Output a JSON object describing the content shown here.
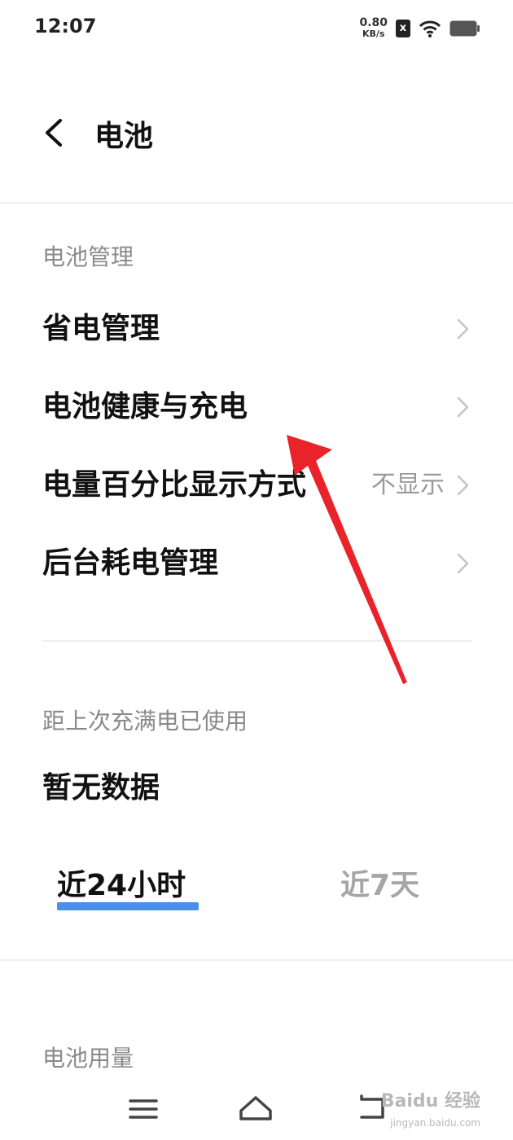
{
  "status_bar": {
    "time": "12:07",
    "net_speed_value": "0.80",
    "net_speed_unit": "KB/s",
    "sim_icon_glyph": "x"
  },
  "header": {
    "title": "电池"
  },
  "battery_management": {
    "section_label": "电池管理",
    "items": [
      {
        "label": "省电管理",
        "value": ""
      },
      {
        "label": "电池健康与充电",
        "value": ""
      },
      {
        "label": "电量百分比显示方式",
        "value": "不显示"
      },
      {
        "label": "后台耗电管理",
        "value": ""
      }
    ]
  },
  "usage_since_charge": {
    "section_label": "距上次充满电已使用",
    "value": "暂无数据"
  },
  "tabs": [
    {
      "label": "近24小时",
      "active": true
    },
    {
      "label": "近7天",
      "active": false
    }
  ],
  "battery_usage": {
    "section_label": "电池用量"
  },
  "nav_bar": {
    "icons": [
      "menu-icon",
      "home-icon",
      "back-icon"
    ]
  },
  "watermark": {
    "brand": "Baidu 经验",
    "url": "jingyan.baidu.com"
  },
  "colors": {
    "accent": "#4a90e8",
    "annotation_arrow": "#e8232a"
  }
}
